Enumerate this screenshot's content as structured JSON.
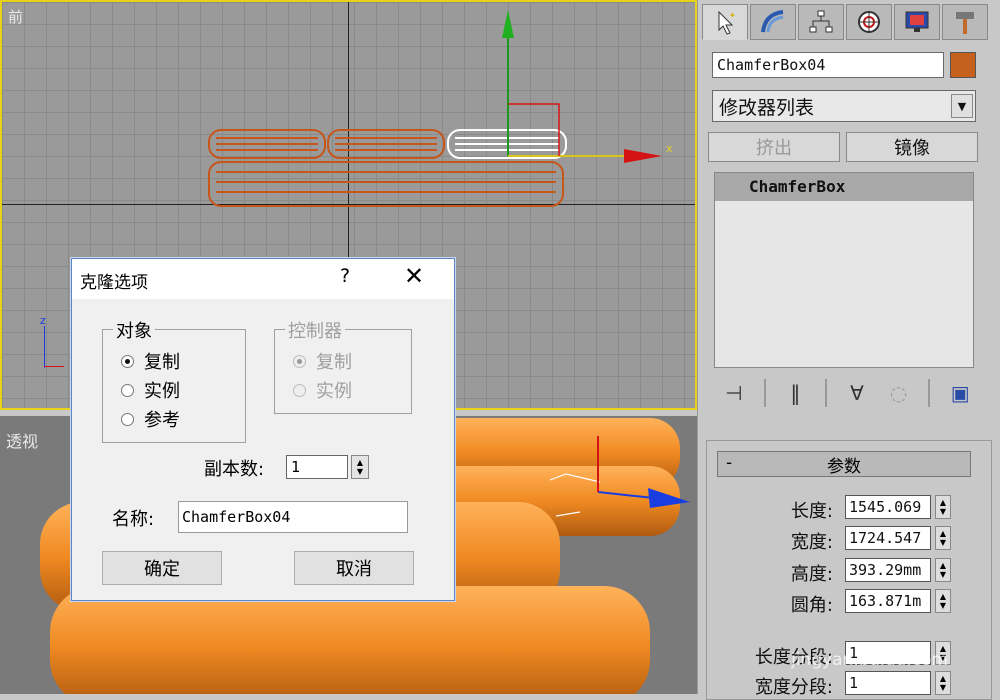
{
  "viewports": {
    "front_label": "前",
    "perspective_label": "透视",
    "axis_x": "x",
    "axis_z": "z"
  },
  "panel": {
    "tabs": [
      {
        "icon": "select-cursor-icon"
      },
      {
        "icon": "modify-arc-icon"
      },
      {
        "icon": "hierarchy-icon"
      },
      {
        "icon": "motion-icon"
      },
      {
        "icon": "display-monitor-icon"
      },
      {
        "icon": "utilities-hammer-icon"
      }
    ],
    "object_name": "ChamferBox04",
    "object_color": "#c5611d",
    "modifier_list": "修改器列表",
    "extrude_button": "挤出",
    "mirror_button": "镜像",
    "stack_item": "ChamferBox"
  },
  "parameters": {
    "title": "参数",
    "collapse": "-",
    "rows": [
      {
        "label": "长度:",
        "value": "1545.069"
      },
      {
        "label": "宽度:",
        "value": "1724.547"
      },
      {
        "label": "高度:",
        "value": "393.29mm"
      },
      {
        "label": "圆角:",
        "value": "163.871m"
      },
      {
        "label": "长度分段:",
        "value": "1"
      },
      {
        "label": "宽度分段:",
        "value": "1"
      }
    ]
  },
  "dialog": {
    "title": "克隆选项",
    "help": "?",
    "close": "✕",
    "object_group": "对象",
    "object_options": [
      "复制",
      "实例",
      "参考"
    ],
    "object_selected": 0,
    "controller_group": "控制器",
    "controller_options": [
      "复制",
      "实例"
    ],
    "copies_label": "副本数:",
    "copies_value": "1",
    "name_label": "名称:",
    "name_value": "ChamferBox04",
    "ok": "确定",
    "cancel": "取消"
  },
  "watermark": "jingyan.baidu.com"
}
